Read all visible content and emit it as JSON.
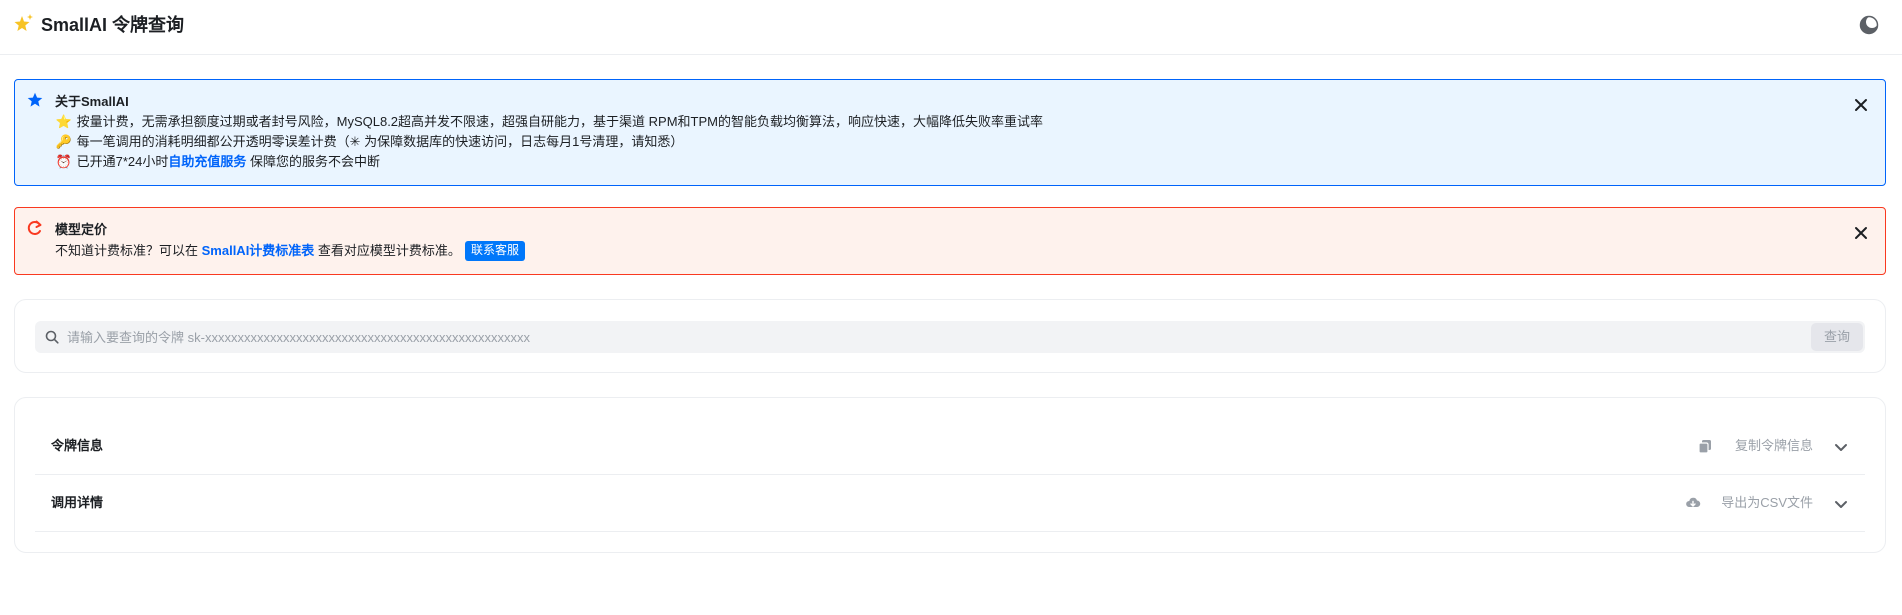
{
  "header": {
    "title": "SmallAI 令牌查询",
    "logo_icon": "sparkle-star-icon",
    "theme_icon": "theme-toggle-icon"
  },
  "about_banner": {
    "title": "关于SmallAI",
    "icon": "star-icon",
    "lines": [
      {
        "emoji": "⭐",
        "text": "按量计费，无需承担额度过期或者封号风险，MySQL8.2超高并发不限速，超强自研能力，基于渠道 RPM和TPM的智能负载均衡算法，响应快速，大幅降低失败率重试率"
      },
      {
        "emoji": "🔑",
        "text": "每一笔调用的消耗明细都公开透明零误差计费（✳ 为保障数据库的快速访问，日志每月1号清理，请知悉）"
      },
      {
        "emoji": "⏰",
        "text_before": "已开通7*24小时",
        "link": "自助充值服务",
        "text_after": " 保障您的服务不会中断"
      }
    ]
  },
  "pricing_banner": {
    "title": "模型定价",
    "icon": "redirect-arrow-icon",
    "text_before": "不知道计费标准？可以在 ",
    "link": "SmallAI计费标准表",
    "text_after": " 查看对应模型计费标准。",
    "chip": "联系客服"
  },
  "search": {
    "placeholder": "请输入要查询的令牌 sk-xxxxxxxxxxxxxxxxxxxxxxxxxxxxxxxxxxxxxxxxxxxxxxxxxx",
    "value": "",
    "button": "查询"
  },
  "sections": [
    {
      "title": "令牌信息",
      "action": "复制令牌信息",
      "action_icon": "copy-icon"
    },
    {
      "title": "调用详情",
      "action": "导出为CSV文件",
      "action_icon": "cloud-download-icon"
    }
  ],
  "colors": {
    "info_bg": "#eaf5ff",
    "info_border": "#0064fa",
    "warn_bg": "#fef2ed",
    "warn_border": "#f93920",
    "link": "#0064fa",
    "chip": "#0077fa"
  }
}
